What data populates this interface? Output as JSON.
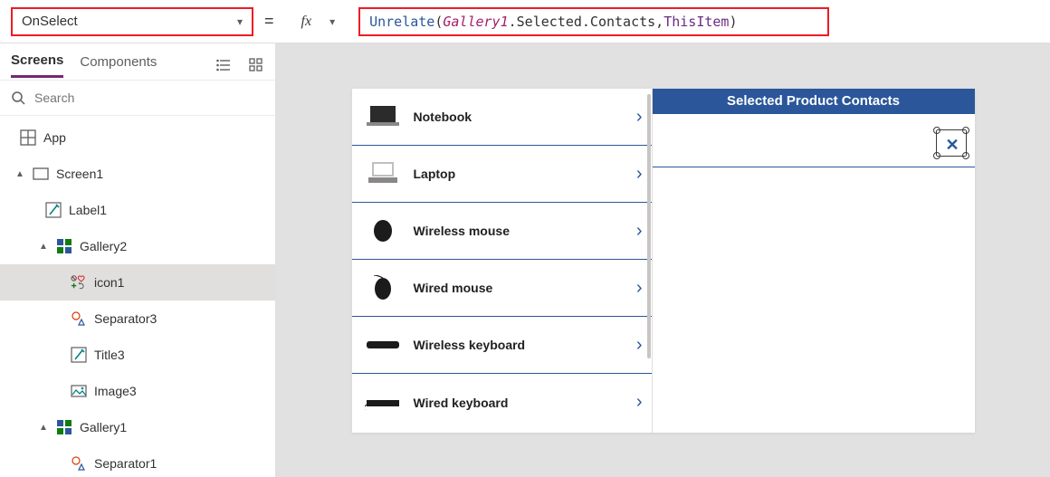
{
  "formula_bar": {
    "property": "OnSelect",
    "fn": "Unrelate",
    "open": "( ",
    "id": "Gallery1",
    "member": ".Selected.Contacts, ",
    "thisitem": "ThisItem",
    "close": " )"
  },
  "left": {
    "tabs": {
      "screens": "Screens",
      "components": "Components"
    },
    "search_placeholder": "Search",
    "tree": {
      "app": "App",
      "screen1": "Screen1",
      "label1": "Label1",
      "gallery2": "Gallery2",
      "icon1": "icon1",
      "separator3": "Separator3",
      "title3": "Title3",
      "image3": "Image3",
      "gallery1": "Gallery1",
      "separator1": "Separator1"
    }
  },
  "canvas": {
    "gallery1_items": [
      {
        "title": "Notebook"
      },
      {
        "title": "Laptop"
      },
      {
        "title": "Wireless mouse"
      },
      {
        "title": "Wired mouse"
      },
      {
        "title": "Wireless keyboard"
      },
      {
        "title": "Wired keyboard"
      }
    ],
    "contacts_header": "Selected Product Contacts"
  }
}
